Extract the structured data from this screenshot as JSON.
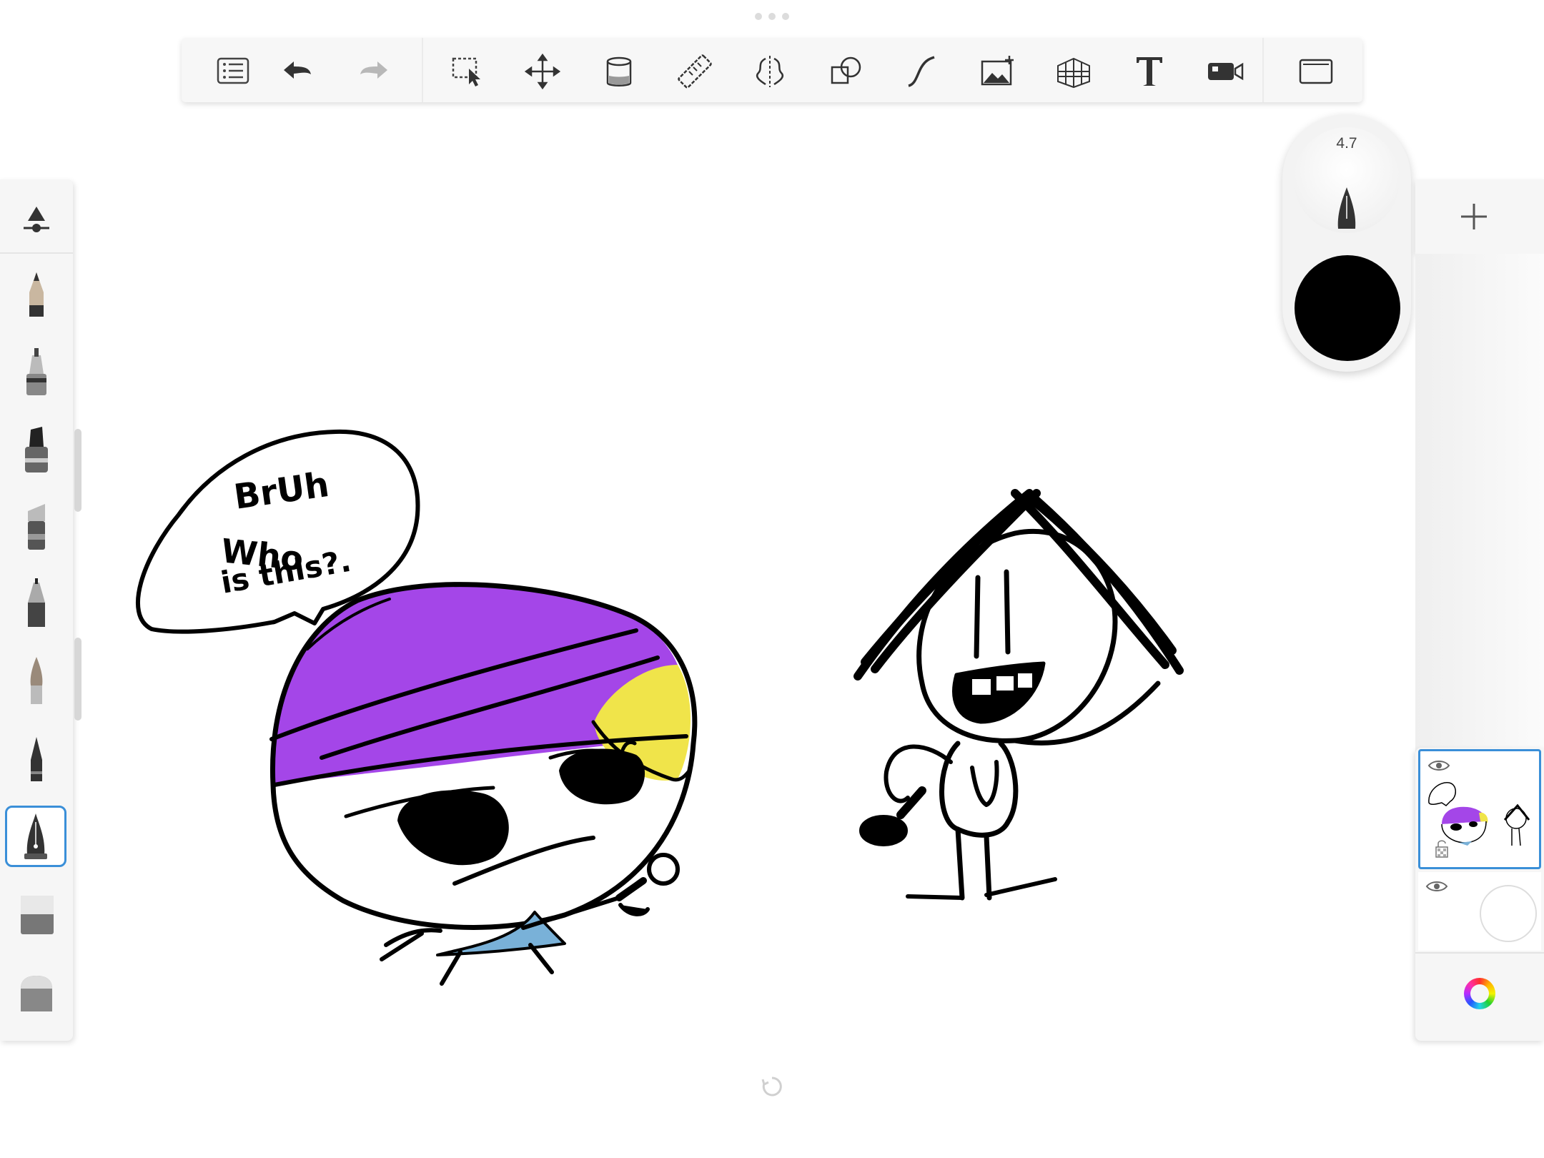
{
  "toolbar": {
    "items": [
      "menu-icon",
      "undo-icon",
      "redo-icon",
      "select-icon",
      "transform-icon",
      "fill-icon",
      "ruler-icon",
      "symmetry-icon",
      "shapes-icon",
      "steady-stroke-icon",
      "import-image-icon",
      "perspective-guide-icon",
      "text-icon",
      "time-lapse-icon",
      "fullscreen-icon"
    ]
  },
  "brushes": {
    "items": [
      "pencil",
      "technical-pen",
      "marker",
      "chisel-marker",
      "fineliner",
      "paint-brush",
      "ink-pen",
      "fountain-pen",
      "soft-eraser",
      "hard-eraser"
    ],
    "selected": "fountain-pen"
  },
  "brush_puck": {
    "size": "4.7",
    "color": "#000000"
  },
  "canvas": {
    "speech_text": [
      "BrUh",
      "Who",
      "is this?."
    ],
    "colors": {
      "hat": "#a446e8",
      "hair": "#f0e44a",
      "shirt": "#79b1d8",
      "ink": "#000000"
    }
  },
  "layers": {
    "count": 2,
    "selected_index": 0
  },
  "colors": {
    "accent": "#3a8fd8",
    "panel": "#f6f6f6"
  }
}
